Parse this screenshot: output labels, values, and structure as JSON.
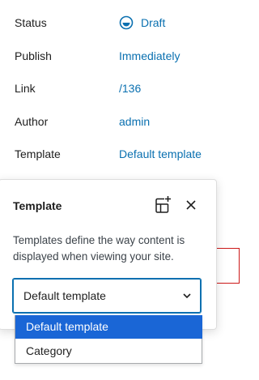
{
  "summary": {
    "status": {
      "label": "Status",
      "value": "Draft"
    },
    "publish": {
      "label": "Publish",
      "value": "Immediately"
    },
    "link": {
      "label": "Link",
      "value": "/136"
    },
    "author": {
      "label": "Author",
      "value": "admin"
    },
    "template": {
      "label": "Template",
      "value": "Default template"
    }
  },
  "popover": {
    "title": "Template",
    "description": "Templates define the way content is displayed when viewing your site.",
    "select": {
      "value": "Default template",
      "options": [
        "Default template",
        "Category"
      ]
    }
  },
  "icons": {
    "status": "draft-circle-icon",
    "add_template": "add-template-icon",
    "close": "close-icon",
    "chevron": "chevron-down-icon"
  },
  "colors": {
    "link": "#0a70b0",
    "selected_option": "#1a66d6",
    "error_border": "#cc1818"
  }
}
